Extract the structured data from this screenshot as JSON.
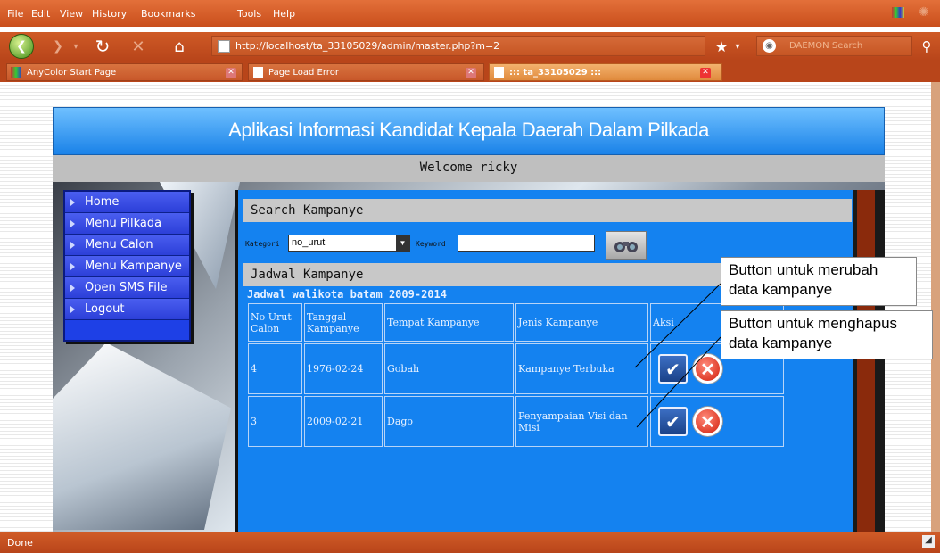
{
  "menu": {
    "items": [
      "File",
      "Edit",
      "View",
      "History",
      "Bookmarks",
      "Tools",
      "Help"
    ]
  },
  "url": "http://localhost/ta_33105029/admin/master.php?m=2",
  "search_placeholder": "DAEMON Search",
  "tabs": [
    {
      "label": "AnyColor Start Page"
    },
    {
      "label": "Page Load Error"
    },
    {
      "label": "::: ta_33105029 :::"
    }
  ],
  "status": "Done",
  "banner_title": "Aplikasi Informasi Kandidat Kepala Daerah Dalam Pilkada",
  "welcome": "Welcome ricky",
  "sidebar": {
    "items": [
      "Home",
      "Menu Pilkada",
      "Menu Calon",
      "Menu Kampanye",
      "Open SMS File",
      "Logout"
    ]
  },
  "search": {
    "title": "Search Kampanye",
    "kategori_label": "Kategori",
    "kategori_value": "no_urut",
    "keyword_label": "Keyword",
    "keyword_value": ""
  },
  "jadwal": {
    "title": "Jadwal Kampanye",
    "subtitle": "Jadwal walikota batam 2009-2014",
    "headers": [
      "No Urut Calon",
      "Tanggal Kampanye",
      "Tempat Kampanye",
      "Jenis Kampanye",
      "Aksi"
    ],
    "rows": [
      {
        "no": "4",
        "tanggal": "1976-02-24",
        "tempat": "Gobah",
        "jenis": "Kampanye Terbuka"
      },
      {
        "no": "3",
        "tanggal": "2009-02-21",
        "tempat": "Dago",
        "jenis": "Penyampaian Visi dan Misi"
      }
    ]
  },
  "callouts": {
    "edit": "Button untuk merubah data kampanye",
    "delete": "Button untuk menghapus data kampanye"
  }
}
